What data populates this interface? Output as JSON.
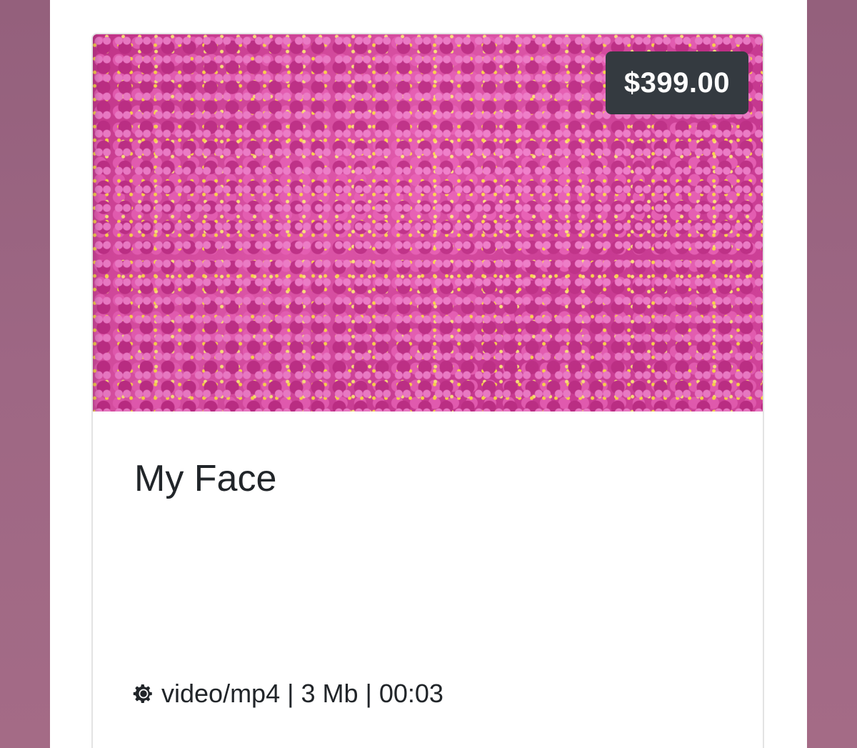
{
  "product": {
    "price": "$399.00",
    "title": "My Face",
    "meta": "video/mp4 | 3 Mb | 00:03",
    "meta_icon": "gear-icon",
    "thumbnail": "pink-hearts-sparkles-image"
  },
  "colors": {
    "background": "#9b6480",
    "badge": "#343a40",
    "text": "#212529",
    "thumbnail_accent": "#d23a95"
  }
}
